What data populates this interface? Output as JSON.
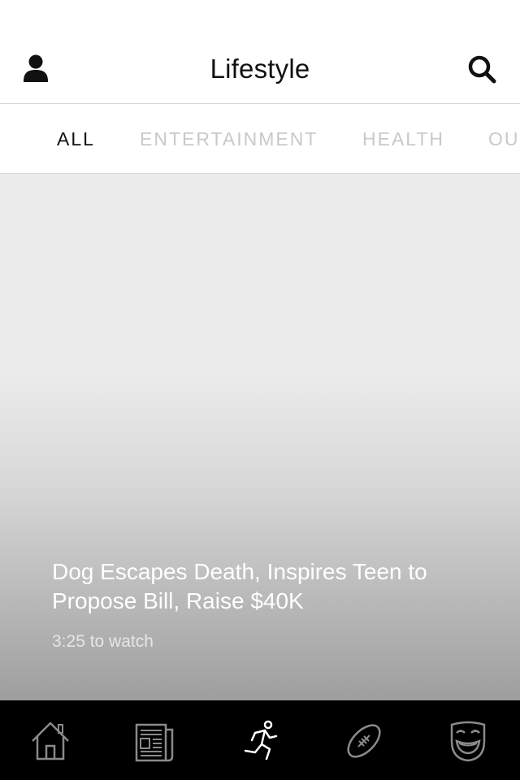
{
  "header": {
    "title": "Lifestyle",
    "profile_icon": "user-icon",
    "search_icon": "search-icon"
  },
  "category_tabs": [
    {
      "label": "ALL",
      "active": true
    },
    {
      "label": "ENTERTAINMENT",
      "active": false
    },
    {
      "label": "HEALTH",
      "active": false
    },
    {
      "label": "OU",
      "active": false
    }
  ],
  "featured": {
    "title": "Dog Escapes Death, Inspires Teen to Propose Bill, Raise $40K",
    "duration": "3:25 to watch"
  },
  "bottom_nav": [
    {
      "icon": "home-icon",
      "active": false
    },
    {
      "icon": "newspaper-icon",
      "active": false
    },
    {
      "icon": "runner-icon",
      "active": true
    },
    {
      "icon": "football-icon",
      "active": false
    },
    {
      "icon": "mask-icon",
      "active": false
    }
  ],
  "colors": {
    "active_text": "#111111",
    "inactive_tab": "#c9c9c9",
    "tab_bar_bg": "#000000",
    "inactive_icon": "#8a8a8a",
    "active_icon": "#ffffff"
  }
}
